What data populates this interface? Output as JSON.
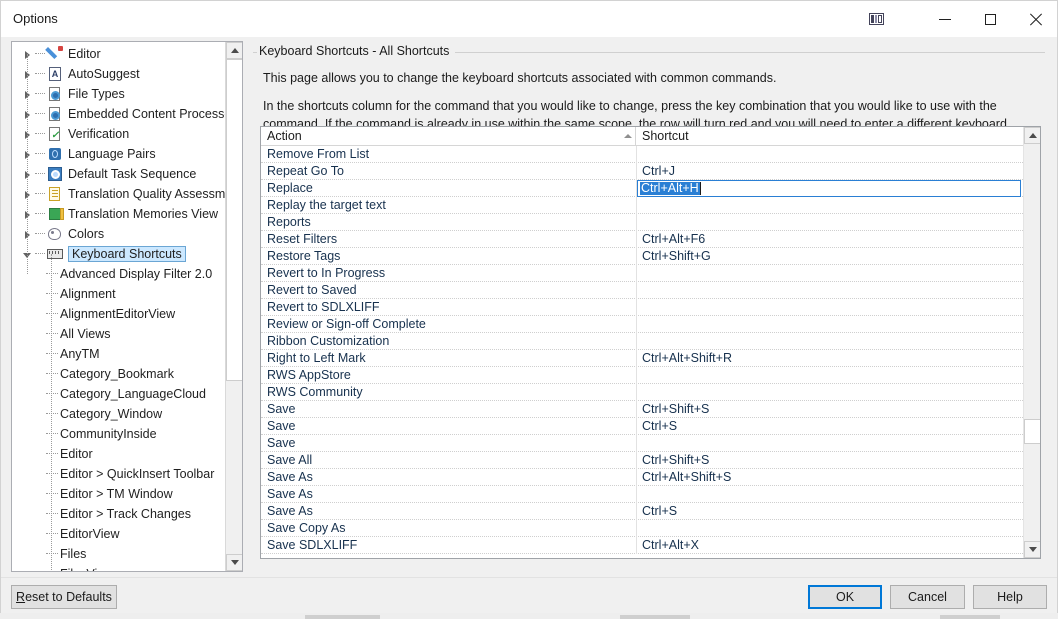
{
  "window": {
    "title": "Options",
    "controls": {
      "layout_icon": "layout-panel-icon",
      "minimize_label": "—",
      "maximize_label": "▢",
      "close_label": "✕"
    }
  },
  "sidebar": {
    "items": [
      {
        "label": "Editor",
        "icon": "pencil-icon",
        "level": 0,
        "state": "collapsed",
        "selected": false
      },
      {
        "label": "AutoSuggest",
        "icon": "autosuggest-icon",
        "level": 0,
        "state": "collapsed",
        "selected": false
      },
      {
        "label": "File Types",
        "icon": "gear-doc-icon",
        "level": 0,
        "state": "collapsed",
        "selected": false
      },
      {
        "label": "Embedded Content Processors",
        "icon": "gear-doc-icon",
        "level": 0,
        "state": "collapsed",
        "selected": false
      },
      {
        "label": "Verification",
        "icon": "doc-check-icon",
        "level": 0,
        "state": "collapsed",
        "selected": false
      },
      {
        "label": "Language Pairs",
        "icon": "globe-icon",
        "level": 0,
        "state": "collapsed",
        "selected": false
      },
      {
        "label": "Default Task Sequence",
        "icon": "gear-blue-icon",
        "level": 0,
        "state": "collapsed",
        "selected": false
      },
      {
        "label": "Translation Quality Assessment",
        "icon": "clipboard-icon",
        "level": 0,
        "state": "collapsed",
        "selected": false
      },
      {
        "label": "Translation Memories View",
        "icon": "memory-bars-icon",
        "level": 0,
        "state": "collapsed",
        "selected": false
      },
      {
        "label": "Colors",
        "icon": "palette-icon",
        "level": 0,
        "state": "collapsed",
        "selected": false
      },
      {
        "label": "Keyboard Shortcuts",
        "icon": "keyboard-icon",
        "level": 0,
        "state": "expanded",
        "selected": true
      },
      {
        "label": "Advanced Display Filter 2.0",
        "icon": "",
        "level": 1,
        "state": "leaf",
        "selected": false
      },
      {
        "label": "Alignment",
        "icon": "",
        "level": 1,
        "state": "leaf",
        "selected": false
      },
      {
        "label": "AlignmentEditorView",
        "icon": "",
        "level": 1,
        "state": "leaf",
        "selected": false
      },
      {
        "label": "All Views",
        "icon": "",
        "level": 1,
        "state": "leaf",
        "selected": false
      },
      {
        "label": "AnyTM",
        "icon": "",
        "level": 1,
        "state": "leaf",
        "selected": false
      },
      {
        "label": "Category_Bookmark",
        "icon": "",
        "level": 1,
        "state": "leaf",
        "selected": false
      },
      {
        "label": "Category_LanguageCloud",
        "icon": "",
        "level": 1,
        "state": "leaf",
        "selected": false
      },
      {
        "label": "Category_Window",
        "icon": "",
        "level": 1,
        "state": "leaf",
        "selected": false
      },
      {
        "label": "CommunityInside",
        "icon": "",
        "level": 1,
        "state": "leaf",
        "selected": false
      },
      {
        "label": "Editor",
        "icon": "",
        "level": 1,
        "state": "leaf",
        "selected": false
      },
      {
        "label": "Editor > QuickInsert Toolbar",
        "icon": "",
        "level": 1,
        "state": "leaf",
        "selected": false
      },
      {
        "label": "Editor > TM Window",
        "icon": "",
        "level": 1,
        "state": "leaf",
        "selected": false
      },
      {
        "label": "Editor > Track Changes",
        "icon": "",
        "level": 1,
        "state": "leaf",
        "selected": false
      },
      {
        "label": "EditorView",
        "icon": "",
        "level": 1,
        "state": "leaf",
        "selected": false
      },
      {
        "label": "Files",
        "icon": "",
        "level": 1,
        "state": "leaf",
        "selected": false
      },
      {
        "label": "FilesView",
        "icon": "",
        "level": 1,
        "state": "leaf",
        "selected": false
      }
    ]
  },
  "main": {
    "group_title": "Keyboard Shortcuts - All Shortcuts",
    "description_1": "This page allows you to change the keyboard shortcuts associated with common commands.",
    "description_2": "In the shortcuts column for the command that you would like to change, press the key combination that you would like to use with the command.  If the command is already in use within the same scope, the row will turn red and you will need to enter a different keyboard shortcut.",
    "grid": {
      "columns": [
        "Action",
        "Shortcut"
      ],
      "sort_column": "Action",
      "sort_direction": "ascending",
      "rows": [
        {
          "action": "Remove From List",
          "shortcut": "",
          "selected": false,
          "editing": false
        },
        {
          "action": "Repeat Go To",
          "shortcut": "Ctrl+J",
          "selected": false,
          "editing": false
        },
        {
          "action": "Replace",
          "shortcut": "Ctrl+Alt+H",
          "selected": true,
          "editing": true
        },
        {
          "action": "Replay the target text",
          "shortcut": "",
          "selected": false,
          "editing": false
        },
        {
          "action": "Reports",
          "shortcut": "",
          "selected": false,
          "editing": false
        },
        {
          "action": "Reset Filters",
          "shortcut": "Ctrl+Alt+F6",
          "selected": false,
          "editing": false
        },
        {
          "action": "Restore Tags",
          "shortcut": "Ctrl+Shift+G",
          "selected": false,
          "editing": false
        },
        {
          "action": "Revert to In Progress",
          "shortcut": "",
          "selected": false,
          "editing": false
        },
        {
          "action": "Revert to Saved",
          "shortcut": "",
          "selected": false,
          "editing": false
        },
        {
          "action": "Revert to SDLXLIFF",
          "shortcut": "",
          "selected": false,
          "editing": false
        },
        {
          "action": "Review or Sign-off Complete",
          "shortcut": "",
          "selected": false,
          "editing": false
        },
        {
          "action": "Ribbon Customization",
          "shortcut": "",
          "selected": false,
          "editing": false
        },
        {
          "action": "Right to Left Mark",
          "shortcut": "Ctrl+Alt+Shift+R",
          "selected": false,
          "editing": false
        },
        {
          "action": "RWS AppStore",
          "shortcut": "",
          "selected": false,
          "editing": false
        },
        {
          "action": "RWS Community",
          "shortcut": "",
          "selected": false,
          "editing": false
        },
        {
          "action": "Save",
          "shortcut": "Ctrl+Shift+S",
          "selected": false,
          "editing": false
        },
        {
          "action": "Save",
          "shortcut": "Ctrl+S",
          "selected": false,
          "editing": false
        },
        {
          "action": "Save",
          "shortcut": "",
          "selected": false,
          "editing": false
        },
        {
          "action": "Save All",
          "shortcut": "Ctrl+Shift+S",
          "selected": false,
          "editing": false
        },
        {
          "action": "Save As",
          "shortcut": "Ctrl+Alt+Shift+S",
          "selected": false,
          "editing": false
        },
        {
          "action": "Save As",
          "shortcut": "",
          "selected": false,
          "editing": false
        },
        {
          "action": "Save As",
          "shortcut": "Ctrl+S",
          "selected": false,
          "editing": false
        },
        {
          "action": "Save Copy As",
          "shortcut": "",
          "selected": false,
          "editing": false
        },
        {
          "action": "Save SDLXLIFF",
          "shortcut": "Ctrl+Alt+X",
          "selected": false,
          "editing": false
        }
      ]
    }
  },
  "footer": {
    "reset_label": "Reset to Defaults",
    "reset_mnemonic": "R",
    "ok_label": "OK",
    "cancel_label": "Cancel",
    "help_label": "Help"
  },
  "colors": {
    "accent": "#0078d7",
    "selection": "#cbe4f7",
    "edit_selection": "#2a7fd4",
    "window_bg": "#f0f0f0",
    "text": "#1b1b1b"
  }
}
